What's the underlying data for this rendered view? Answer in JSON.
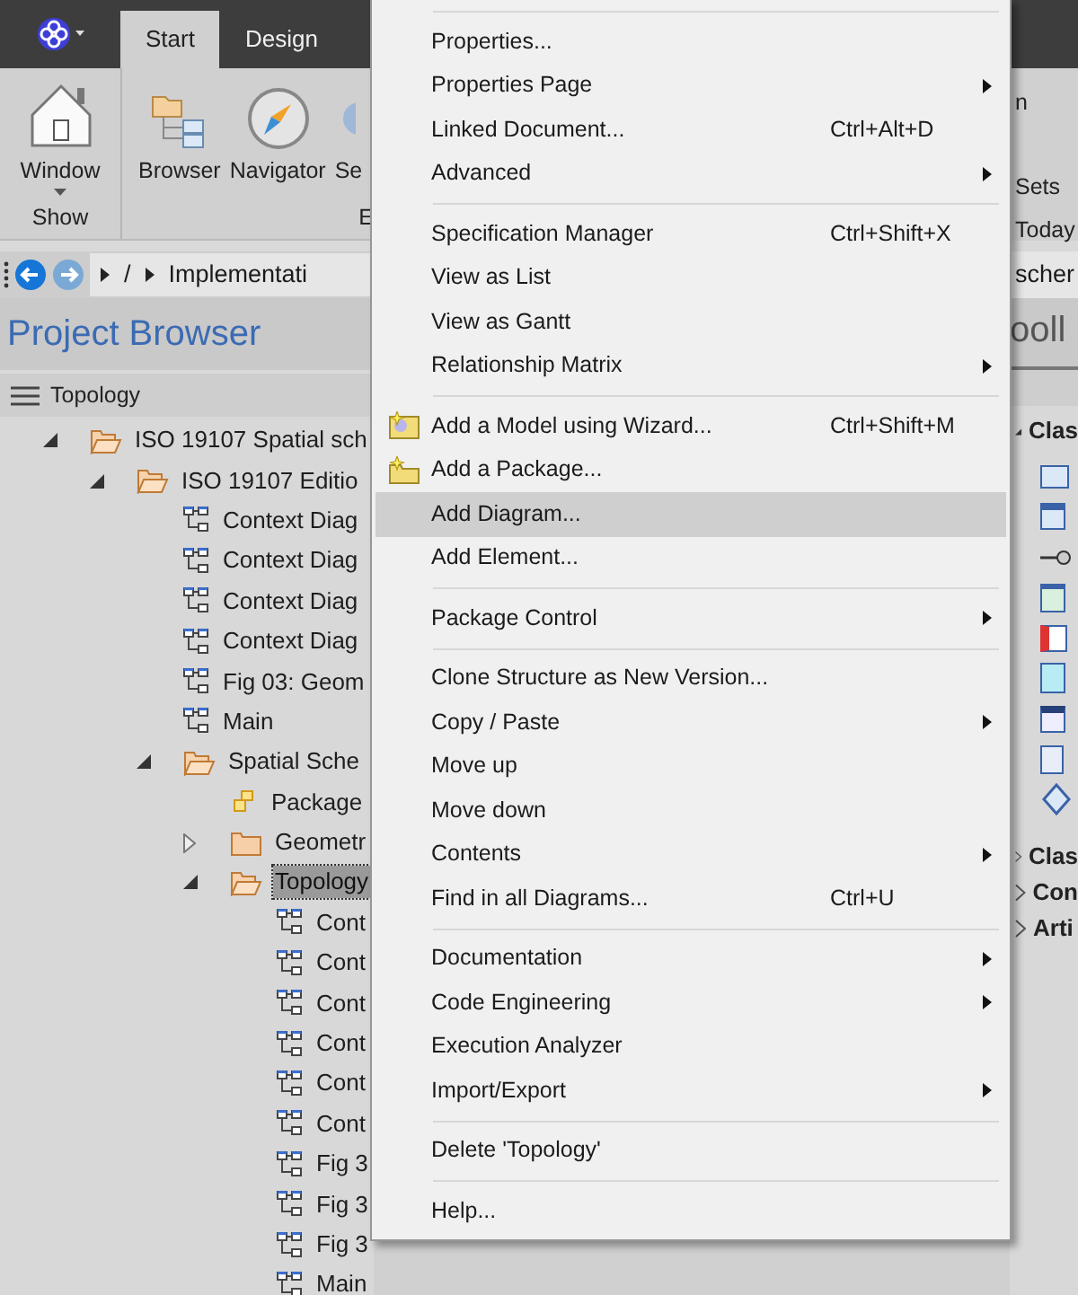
{
  "ribbon_tabs": [
    {
      "label": "Start",
      "selected": true
    },
    {
      "label": "Design",
      "selected": false
    }
  ],
  "ribbon": {
    "groups": [
      {
        "label": "Show",
        "buttons": [
          {
            "label": "Window",
            "kind": "window",
            "dropdown": true
          }
        ]
      },
      {
        "label": "E",
        "buttons": [
          {
            "label": "Browser",
            "kind": "browser",
            "dropdown": false
          },
          {
            "label": "Navigator",
            "kind": "navigator",
            "dropdown": false
          },
          {
            "label": "Se",
            "kind": "cut",
            "dropdown": false
          }
        ]
      }
    ]
  },
  "breadcrumb": {
    "path": [
      "/",
      "Implementati"
    ]
  },
  "project_browser": {
    "title": "Project Browser",
    "header": "Topology",
    "tree": [
      {
        "label": "ISO 19107 Spatial sch",
        "kind": "folder",
        "expanded": true,
        "selected": false,
        "children": [
          {
            "label": "ISO 19107 Editio",
            "kind": "folder",
            "expanded": true,
            "selected": false,
            "children": [
              {
                "label": "Context Diag",
                "kind": "diagram",
                "selected": false
              },
              {
                "label": "Context Diag",
                "kind": "diagram",
                "selected": false
              },
              {
                "label": "Context Diag",
                "kind": "diagram",
                "selected": false
              },
              {
                "label": "Context Diag",
                "kind": "diagram",
                "selected": false
              },
              {
                "label": "Fig 03: Geom",
                "kind": "diagram",
                "selected": false
              },
              {
                "label": "Main",
                "kind": "diagram",
                "selected": false
              },
              {
                "label": "Spatial Sche",
                "kind": "folder",
                "expanded": true,
                "selected": false,
                "children": [
                  {
                    "label": "Package",
                    "kind": "package",
                    "selected": false
                  },
                  {
                    "label": "Geometr",
                    "kind": "folder",
                    "expanded": false,
                    "selected": false
                  },
                  {
                    "label": "Topology",
                    "kind": "folder",
                    "expanded": true,
                    "selected": true,
                    "children": [
                      {
                        "label": "Cont",
                        "kind": "diagram",
                        "selected": false
                      },
                      {
                        "label": "Cont",
                        "kind": "diagram",
                        "selected": false
                      },
                      {
                        "label": "Cont",
                        "kind": "diagram",
                        "selected": false
                      },
                      {
                        "label": "Cont",
                        "kind": "diagram",
                        "selected": false
                      },
                      {
                        "label": "Cont",
                        "kind": "diagram",
                        "selected": false
                      },
                      {
                        "label": "Cont",
                        "kind": "diagram",
                        "selected": false
                      },
                      {
                        "label": "Fig 3",
                        "kind": "diagram",
                        "selected": false
                      },
                      {
                        "label": "Fig 3",
                        "kind": "diagram",
                        "selected": false
                      },
                      {
                        "label": "Fig 3",
                        "kind": "diagram",
                        "selected": false
                      },
                      {
                        "label": "Main",
                        "kind": "diagram",
                        "selected": false
                      }
                    ]
                  }
                ]
              }
            ]
          }
        ]
      }
    ]
  },
  "context_menu": {
    "items": [
      {
        "kind": "separator"
      },
      {
        "kind": "item",
        "label": "Properties...",
        "selected": false,
        "submenu": false
      },
      {
        "kind": "item",
        "label": "Properties Page",
        "selected": false,
        "submenu": true
      },
      {
        "kind": "item",
        "label": "Linked Document...",
        "shortcut": "Ctrl+Alt+D",
        "selected": false,
        "submenu": false
      },
      {
        "kind": "item",
        "label": "Advanced",
        "selected": false,
        "submenu": true
      },
      {
        "kind": "separator"
      },
      {
        "kind": "item",
        "label": "Specification Manager",
        "shortcut": "Ctrl+Shift+X",
        "selected": false,
        "submenu": false
      },
      {
        "kind": "item",
        "label": "View as List",
        "selected": false,
        "submenu": false
      },
      {
        "kind": "item",
        "label": "View as Gantt",
        "selected": false,
        "submenu": false
      },
      {
        "kind": "item",
        "label": "Relationship Matrix",
        "selected": false,
        "submenu": true
      },
      {
        "kind": "separator"
      },
      {
        "kind": "wizard",
        "label": "Add a Model using Wizard...",
        "shortcut": "Ctrl+Shift+M",
        "selected": false,
        "submenu": false
      },
      {
        "kind": "newpackage",
        "label": "Add a Package...",
        "selected": false,
        "submenu": false
      },
      {
        "kind": "item",
        "label": "Add Diagram...",
        "selected": true,
        "submenu": false
      },
      {
        "kind": "item",
        "label": "Add Element...",
        "selected": false,
        "submenu": false
      },
      {
        "kind": "separator"
      },
      {
        "kind": "item",
        "label": "Package Control",
        "selected": false,
        "submenu": true
      },
      {
        "kind": "separator"
      },
      {
        "kind": "item",
        "label": "Clone Structure as New Version...",
        "selected": false,
        "submenu": false
      },
      {
        "kind": "item",
        "label": "Copy / Paste",
        "selected": false,
        "submenu": true
      },
      {
        "kind": "item",
        "label": "Move up",
        "selected": false,
        "submenu": false
      },
      {
        "kind": "item",
        "label": "Move down",
        "selected": false,
        "submenu": false
      },
      {
        "kind": "item",
        "label": "Contents",
        "selected": false,
        "submenu": true
      },
      {
        "kind": "item",
        "label": "Find in all Diagrams...",
        "shortcut": "Ctrl+U",
        "selected": false,
        "submenu": false
      },
      {
        "kind": "separator"
      },
      {
        "kind": "item",
        "label": "Documentation",
        "selected": false,
        "submenu": true
      },
      {
        "kind": "item",
        "label": "Code Engineering",
        "selected": false,
        "submenu": true
      },
      {
        "kind": "item",
        "label": "Execution Analyzer",
        "selected": false,
        "submenu": false
      },
      {
        "kind": "item",
        "label": "Import/Export",
        "selected": false,
        "submenu": true
      },
      {
        "kind": "separator"
      },
      {
        "kind": "item",
        "label": "Delete 'Topology'",
        "selected": false,
        "submenu": false
      },
      {
        "kind": "separator"
      },
      {
        "kind": "item",
        "label": "Help...",
        "selected": false,
        "submenu": false
      }
    ]
  },
  "right_panel": {
    "ribbon_label": "n",
    "group_label": "Sets",
    "group_label_2": "Today",
    "breadcrumb": "scher",
    "title": "ooll",
    "sections": [
      {
        "label": "Clas",
        "expanded": true
      },
      {
        "label": "Clas",
        "expanded": false
      },
      {
        "label": "Con",
        "expanded": false
      },
      {
        "label": "Arti",
        "expanded": false
      }
    ]
  }
}
